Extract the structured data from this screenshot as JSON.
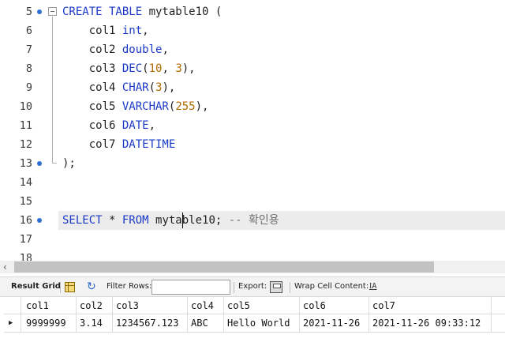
{
  "editor": {
    "lines": [
      {
        "num": "5",
        "dot": true,
        "fold": true,
        "tokens": [
          [
            "kw",
            "CREATE TABLE "
          ],
          [
            "t",
            "mytable10 ("
          ]
        ]
      },
      {
        "num": "6",
        "tokens": [
          [
            "t",
            "    col1 "
          ],
          [
            "kw",
            "int"
          ],
          [
            "t",
            ","
          ]
        ]
      },
      {
        "num": "7",
        "tokens": [
          [
            "t",
            "    col2 "
          ],
          [
            "kw",
            "double"
          ],
          [
            "t",
            ","
          ]
        ]
      },
      {
        "num": "8",
        "tokens": [
          [
            "t",
            "    col3 "
          ],
          [
            "kw",
            "DEC"
          ],
          [
            "t",
            "("
          ],
          [
            "num",
            "10"
          ],
          [
            "t",
            ", "
          ],
          [
            "num",
            "3"
          ],
          [
            "t",
            "),"
          ]
        ]
      },
      {
        "num": "9",
        "tokens": [
          [
            "t",
            "    col4 "
          ],
          [
            "kw",
            "CHAR"
          ],
          [
            "t",
            "("
          ],
          [
            "num",
            "3"
          ],
          [
            "t",
            "),"
          ]
        ]
      },
      {
        "num": "10",
        "tokens": [
          [
            "t",
            "    col5 "
          ],
          [
            "kw",
            "VARCHAR"
          ],
          [
            "t",
            "("
          ],
          [
            "num",
            "255"
          ],
          [
            "t",
            "),"
          ]
        ]
      },
      {
        "num": "11",
        "tokens": [
          [
            "t",
            "    col6 "
          ],
          [
            "kw",
            "DATE"
          ],
          [
            "t",
            ","
          ]
        ]
      },
      {
        "num": "12",
        "tokens": [
          [
            "t",
            "    col7 "
          ],
          [
            "kw",
            "DATETIME"
          ]
        ]
      },
      {
        "num": "13",
        "dot": true,
        "tokens": [
          [
            "t",
            ");"
          ]
        ]
      },
      {
        "num": "14",
        "tokens": []
      },
      {
        "num": "15",
        "tokens": []
      },
      {
        "num": "16",
        "dot": true,
        "current": true,
        "tokens": [
          [
            "kw",
            "SELECT"
          ],
          [
            "t",
            " * "
          ],
          [
            "kw",
            "FROM"
          ],
          [
            "t",
            " mytable10; "
          ],
          [
            "cmt",
            "-- 확인용"
          ]
        ]
      },
      {
        "num": "17",
        "tokens": []
      },
      {
        "num": "18",
        "tokens": []
      }
    ]
  },
  "toolbar": {
    "result_grid_label": "Result Grid",
    "filter_rows_label": "Filter Rows:",
    "filter_value": "",
    "export_label": "Export:",
    "wrap_label": "Wrap Cell Content:",
    "wrap_icon": "I͟A"
  },
  "grid": {
    "columns": [
      "col1",
      "col2",
      "col3",
      "col4",
      "col5",
      "col6",
      "col7"
    ],
    "rows": [
      [
        "9999999",
        "3.14",
        "1234567.123",
        "ABC",
        "Hello World",
        "2021-11-26",
        "2021-11-26 09:33:12"
      ]
    ]
  }
}
